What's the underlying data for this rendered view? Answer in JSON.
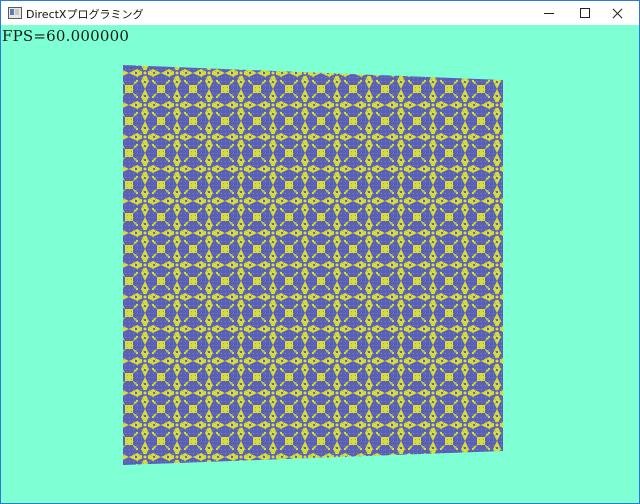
{
  "window": {
    "title": "DirectXプログラミング",
    "icon": "app-window-icon",
    "buttons": {
      "minimize": "minimize-icon",
      "maximize": "maximize-icon",
      "close": "close-icon"
    }
  },
  "overlay": {
    "fps_text": "FPS=60.000000"
  },
  "scene": {
    "background_color": "#7fffd4",
    "texture_primary": "#5a5fb8",
    "texture_secondary": "#d6dc3a"
  }
}
